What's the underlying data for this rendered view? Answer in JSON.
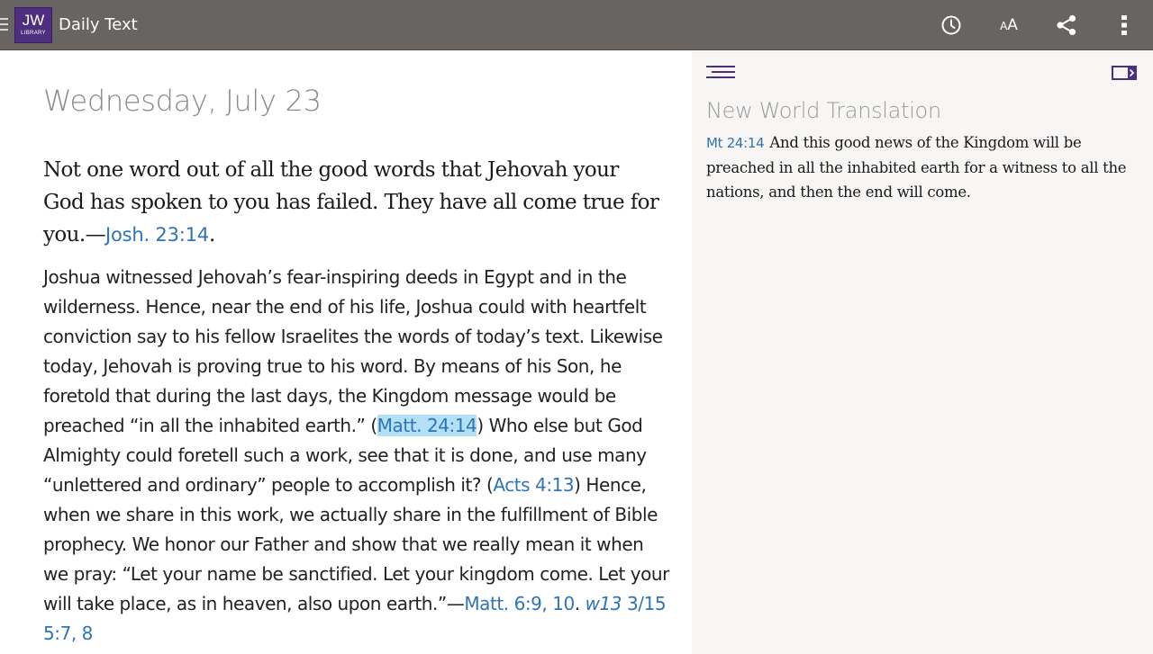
{
  "appbar": {
    "logo_big": "JW",
    "logo_small": "LIBRARY",
    "title": "Daily Text",
    "actions": [
      "history-icon",
      "text-size-icon",
      "share-icon",
      "overflow-menu-icon"
    ],
    "textsize_small": "A",
    "textsize_large": "A",
    "bg_color": "#676461",
    "logo_color": "#4e2e7e"
  },
  "main": {
    "date": "Wednesday, July 23",
    "theme_text": "Not one word out of all the good words that Jehovah your God has spoken to you has failed. They have all come true for you.—",
    "theme_ref": "Josh. 23:14",
    "theme_end": ".",
    "body": {
      "p1": "Joshua witnessed Jehovah’s fear-inspiring deeds in Egypt and in the wilderness. Hence, near the end of his life, Joshua could with heartfelt conviction say to his fellow Israelites the words of today’s text. Likewise today, Jehovah is proving true to his word. By means of his Son, he foretold that during the last days, the Kingdom message would be preached “in all the inhabited earth.” (",
      "ref1": "Matt. 24:14",
      "p2": ") Who else but God Almighty could foretell such a work, see that it is done, and use many “unlettered and ordinary” people to accomplish it? (",
      "ref2": "Acts 4:13",
      "p3": ") Hence, when we share in this work, we actually share in the fulfillment of Bible prophecy. We honor our Father and show that we really mean it when we pray: “Let your name be sanctified. Let your kingdom come. Let your will take place, as in heaven, also upon earth.”—",
      "ref3": "Matt. 6:9, 10",
      "p4": ". ",
      "ref4_italic": "w13",
      "ref4": " 3/15 5:7, 8"
    },
    "link_color": "#2f74b5",
    "highlight_color": "#b3e0f5"
  },
  "side": {
    "title": "New World Translation",
    "verse_ref": "Mt 24:14",
    "verse_text": "And this good news of the Kingdom will be preached in all the inhabited earth for a witness to all the nations, and then the end will come."
  }
}
